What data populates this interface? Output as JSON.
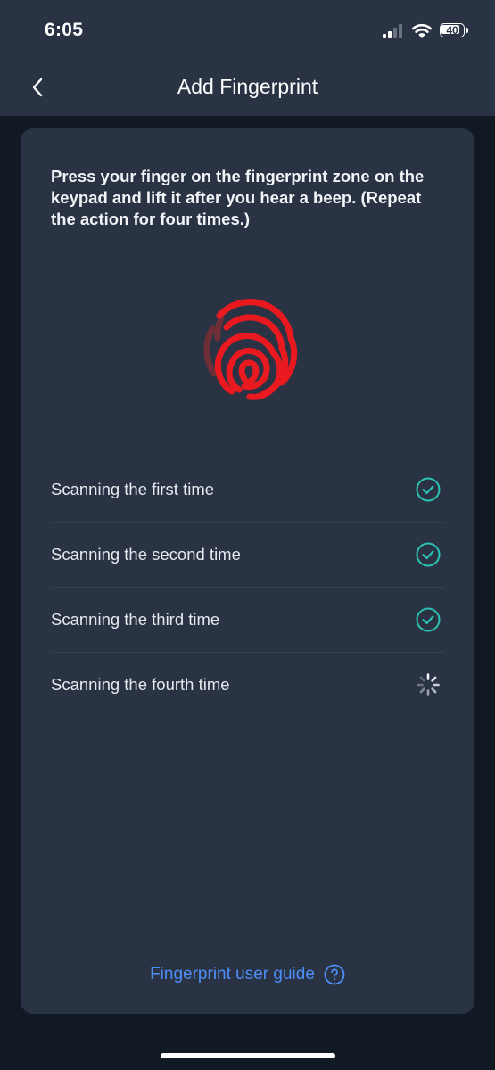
{
  "status_bar": {
    "time": "6:05",
    "battery_level": "40",
    "icons": [
      "signal-icon",
      "wifi-icon",
      "battery-icon"
    ]
  },
  "nav": {
    "title": "Add Fingerprint",
    "back_icon": "chevron-left-icon"
  },
  "instruction": "Press your finger on the fingerprint zone on the keypad and lift it after you hear a beep. (Repeat the action for four times.)",
  "fingerprint": {
    "icon": "fingerprint-icon",
    "progress": 0.75,
    "accent_color": "#e8191f"
  },
  "scans": [
    {
      "label": "Scanning the first time",
      "status": "done",
      "icon": "check-circle-icon"
    },
    {
      "label": "Scanning the second time",
      "status": "done",
      "icon": "check-circle-icon"
    },
    {
      "label": "Scanning the third time",
      "status": "done",
      "icon": "check-circle-icon"
    },
    {
      "label": "Scanning the fourth time",
      "status": "in-progress",
      "icon": "spinner-icon"
    }
  ],
  "guide": {
    "label": "Fingerprint user guide",
    "icon": "question-circle-icon"
  },
  "colors": {
    "background": "#111925",
    "surface": "#293344",
    "success": "#2bc2b3",
    "link": "#4d8ef8",
    "fingerprint": "#e8191f"
  }
}
